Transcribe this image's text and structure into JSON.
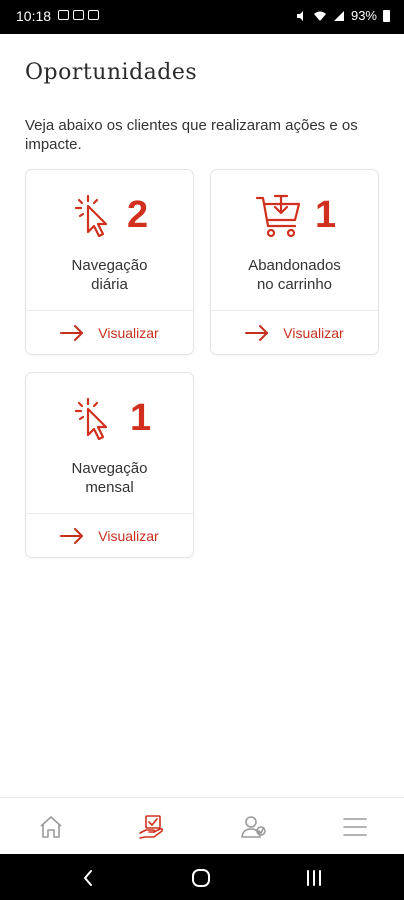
{
  "status_bar": {
    "time": "10:18",
    "battery": "93%"
  },
  "page": {
    "title": "Oportunidades",
    "subtitle": "Veja abaixo os clientes que realizaram ações e os impacte."
  },
  "cards": [
    {
      "count": "2",
      "label": "Navegação\ndiária",
      "action": "Visualizar",
      "icon": "cursor-click-icon"
    },
    {
      "count": "1",
      "label": "Abandonados\nno carrinho",
      "action": "Visualizar",
      "icon": "cart-icon"
    },
    {
      "count": "1",
      "label": "Navegação\nmensal",
      "action": "Visualizar",
      "icon": "cursor-click-icon"
    }
  ],
  "bottom_nav": {
    "items": [
      "home-icon",
      "opportunities-icon",
      "clients-icon",
      "menu-icon"
    ],
    "active_index": 1
  },
  "colors": {
    "accent": "#d0301d",
    "icon_inactive": "#9a9a9a"
  }
}
